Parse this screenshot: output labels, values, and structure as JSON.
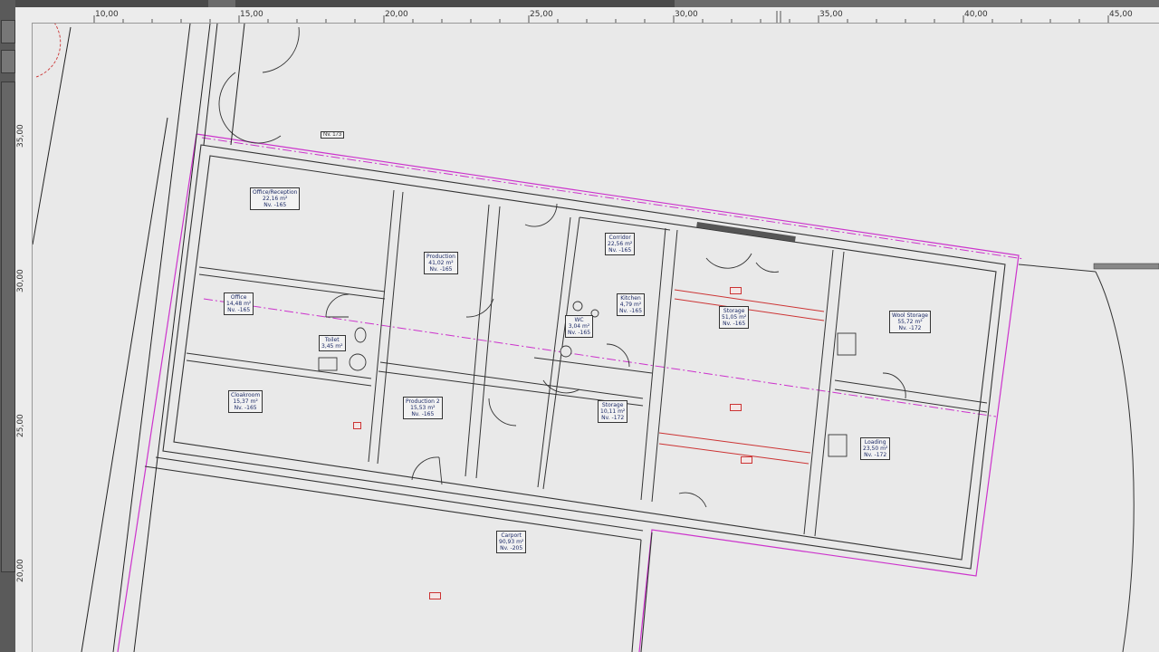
{
  "ruler": {
    "top_ticks": [
      "10,00",
      "15,00",
      "20,00",
      "25,00",
      "30,00",
      "35,00",
      "40,00",
      "45,00"
    ],
    "left_ticks": [
      "35,00",
      "30,00",
      "25,00",
      "20,00"
    ]
  },
  "level_marker": "Nv. 173",
  "rooms": [
    {
      "id": "office-reception",
      "name": "Office/Reception",
      "area": "22,16 m²",
      "level": "Nv. -165"
    },
    {
      "id": "production-1",
      "name": "Production",
      "area": "41,02 m²",
      "level": "Nv. -165"
    },
    {
      "id": "corridor",
      "name": "Corridor",
      "area": "22,56 m²",
      "level": "Nv. -165"
    },
    {
      "id": "office",
      "name": "Office",
      "area": "14,48 m²",
      "level": "Nv. -165"
    },
    {
      "id": "toilet",
      "name": "Toilet",
      "area": "3,45 m²",
      "level": ""
    },
    {
      "id": "kitchen",
      "name": "Kitchen",
      "area": "4,79 m²",
      "level": "Nv. -165"
    },
    {
      "id": "wc",
      "name": "WC",
      "area": "3,04 m²",
      "level": "Nv. -165"
    },
    {
      "id": "storage-1",
      "name": "Storage",
      "area": "51,05 m²",
      "level": "Nv. -165"
    },
    {
      "id": "wool-storage",
      "name": "Wool Storage",
      "area": "55,72 m²",
      "level": "Nv. -172"
    },
    {
      "id": "cloakroom",
      "name": "Cloakroom",
      "area": "15,37 m²",
      "level": "Nv. -165"
    },
    {
      "id": "production-2",
      "name": "Production 2",
      "area": "15,53 m²",
      "level": "Nv. -165"
    },
    {
      "id": "storage-2",
      "name": "Storage",
      "area": "10,11 m²",
      "level": "Nv. -172"
    },
    {
      "id": "loading",
      "name": "Loading",
      "area": "23,50 m²",
      "level": "Nv. -172"
    },
    {
      "id": "carport",
      "name": "Carport",
      "area": "90,93 m²",
      "level": "Nv. -205"
    }
  ],
  "colors": {
    "background": "#e9e9e9",
    "lines": "#333333",
    "property_line": "#cc33cc",
    "red_annotation": "#cc3333",
    "room_text": "#1c2a66"
  }
}
